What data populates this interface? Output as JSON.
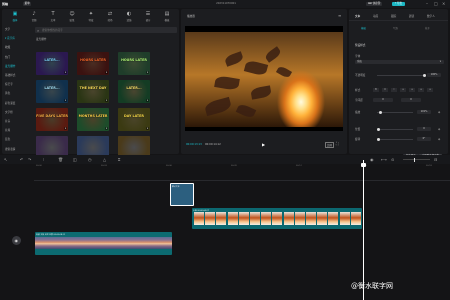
{
  "app": {
    "name": "剪映",
    "menu_label": "菜单",
    "doc_title": "202311070001",
    "shortcut_label": "快捷键",
    "export_label": "导出"
  },
  "toolbar": {
    "items": [
      {
        "label": "媒体",
        "icon": "media-icon",
        "active": true
      },
      {
        "label": "音频",
        "icon": "audio-icon"
      },
      {
        "label": "文本",
        "icon": "text-icon"
      },
      {
        "label": "贴纸",
        "icon": "sticker-icon"
      },
      {
        "label": "特效",
        "icon": "effects-icon"
      },
      {
        "label": "转场",
        "icon": "transition-icon"
      },
      {
        "label": "滤镜",
        "icon": "filter-icon"
      },
      {
        "label": "调节",
        "icon": "adjust-icon"
      },
      {
        "label": "模板",
        "icon": "template-icon"
      }
    ]
  },
  "sidebar": {
    "items": [
      {
        "label": "文字",
        "selected": false
      },
      {
        "label": "▾ 花字库",
        "selected": true
      },
      {
        "label": "收藏",
        "selected": false
      },
      {
        "label": "热门",
        "selected": false
      },
      {
        "label": "发光爆炸",
        "selected": true
      },
      {
        "label": "基础样式",
        "selected": false
      },
      {
        "label": "综艺字",
        "selected": false
      },
      {
        "label": "黄色",
        "selected": false
      },
      {
        "label": "彩色渐变",
        "selected": false
      },
      {
        "label": "文字框",
        "selected": false
      },
      {
        "label": "片头",
        "selected": false
      },
      {
        "label": "片尾",
        "selected": false
      },
      {
        "label": "蓝色",
        "selected": false
      },
      {
        "label": "搜索表情",
        "selected": false
      }
    ]
  },
  "search": {
    "placeholder": "搜索你想找的花字"
  },
  "media": {
    "section_title": "发光爆炸",
    "thumbs": [
      {
        "label": "LATER...",
        "bg": "#2b1850",
        "fg": "#7fd8ff"
      },
      {
        "label": "HOURS LATER",
        "bg": "#3b1210",
        "fg": "#ff6a2a"
      },
      {
        "label": "HOURS LATER",
        "bg": "#1f3d2a",
        "fg": "#b6ff7a"
      },
      {
        "label": "LATER...",
        "bg": "#10304c",
        "fg": "#a7e7ff"
      },
      {
        "label": "THE NEXT DAY",
        "bg": "#2a3514",
        "fg": "#ffe25a"
      },
      {
        "label": "LATER...",
        "bg": "#143c24",
        "fg": "#ffe66d"
      },
      {
        "label": "FIVE DAYS LATER",
        "bg": "#5a1a10",
        "fg": "#ffb347"
      },
      {
        "label": "MONTHS LATER",
        "bg": "#1d4c2a",
        "fg": "#ffd24a"
      },
      {
        "label": "DAY LATER",
        "bg": "#3b3a12",
        "fg": "#ffe04a"
      },
      {
        "label": "",
        "bg": "#3a2a4a",
        "fg": "#ffffff"
      },
      {
        "label": "",
        "bg": "#2a3a5a",
        "fg": "#ffffff"
      },
      {
        "label": "",
        "bg": "#4a3a1a",
        "fg": "#ffffff"
      }
    ]
  },
  "player": {
    "title": "播放器",
    "timecode": "00:00:13:13",
    "duration": "00:00:14:12",
    "ratio_label": "比例"
  },
  "properties": {
    "tabs": [
      "文本",
      "动画",
      "跟踪",
      "朗读",
      "数字人"
    ],
    "subtabs": [
      "基础",
      "气泡",
      "花字"
    ],
    "preset_label": "预设样式",
    "font_label": "字体",
    "font_value": "系统",
    "size_label": "字号",
    "size_value": "15",
    "style_label": "样式",
    "opacity_label": "不透明度",
    "opacity_value": "100%",
    "align_label": "对齐",
    "spacing_label": "字间距",
    "spacing_value": "0",
    "line_label": "行间距",
    "line_value": "0",
    "scale_label": "缩放",
    "scale_value": "101%",
    "pos_label": "位置",
    "pos_x": "0",
    "pos_y": "0",
    "rotate_label": "旋转",
    "rotate_value": "0°",
    "btn_save": "保存预设",
    "btn_apply": "应用到全部字幕"
  },
  "timeline": {
    "ruler": [
      "00:00",
      "00:03",
      "00:06",
      "00:09",
      "00:12",
      "00:15",
      "00:18"
    ],
    "text_clip_label": "默认文本",
    "main_clip_label": "火焰 00:00:04:27",
    "audio_clip_label": "视频 太阳 天空 风景 00:00:08:11",
    "cover_label": "封面"
  },
  "watermark": "@衡水联字网",
  "colors": {
    "accent": "#1cc3d0",
    "bg": "#141416",
    "panel": "#1c1d20"
  }
}
